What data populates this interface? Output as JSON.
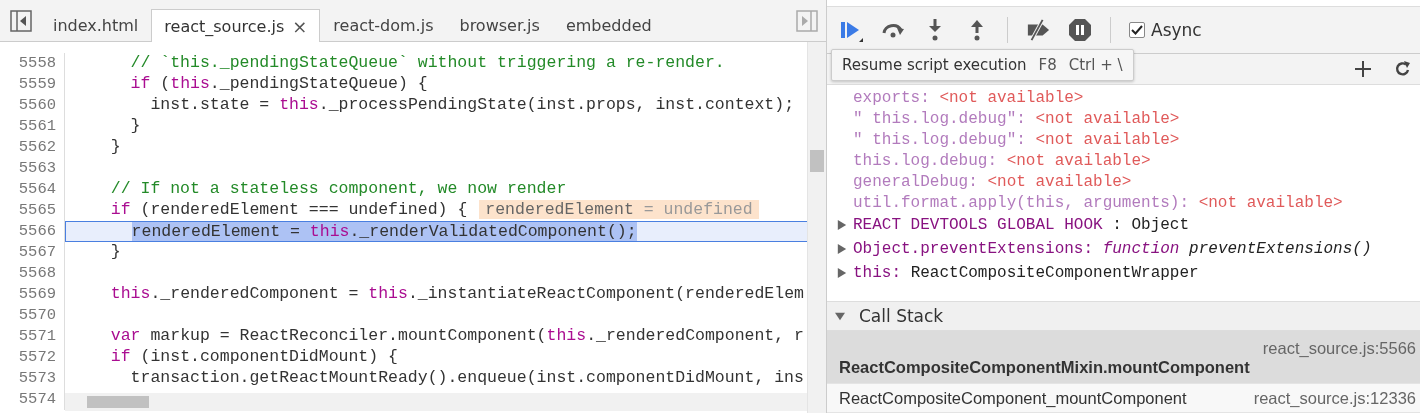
{
  "editor": {
    "tabs": [
      {
        "label": "index.html",
        "selected": false,
        "closable": false
      },
      {
        "label": "react_source.js",
        "selected": true,
        "closable": true
      },
      {
        "label": "react-dom.js",
        "selected": false,
        "closable": false
      },
      {
        "label": "browser.js",
        "selected": false,
        "closable": false
      },
      {
        "label": "embedded",
        "selected": false,
        "closable": false
      }
    ],
    "close_glyph": "×",
    "lines": [
      {
        "number": "5558",
        "segments": [
          {
            "kind": "comment",
            "text": "    // `this._pendingStateQueue` without triggering a re-render."
          }
        ]
      },
      {
        "number": "5559",
        "segments": [
          {
            "kind": "keyword",
            "text": "    if"
          },
          {
            "kind": "plain",
            "text": " ("
          },
          {
            "kind": "this",
            "text": "this"
          },
          {
            "kind": "plain",
            "text": "._pendingStateQueue) {"
          }
        ]
      },
      {
        "number": "5560",
        "segments": [
          {
            "kind": "plain",
            "text": "      inst.state = "
          },
          {
            "kind": "this",
            "text": "this"
          },
          {
            "kind": "plain",
            "text": "._processPendingState(inst.props, inst.context);"
          }
        ]
      },
      {
        "number": "5561",
        "segments": [
          {
            "kind": "plain",
            "text": "    }"
          }
        ]
      },
      {
        "number": "5562",
        "segments": [
          {
            "kind": "plain",
            "text": "  }"
          }
        ]
      },
      {
        "number": "5563"
      },
      {
        "number": "5564",
        "segments": [
          {
            "kind": "comment",
            "text": "  // If not a stateless component, we now render"
          }
        ]
      },
      {
        "number": "5565",
        "segments": [
          {
            "kind": "keyword",
            "text": "  if"
          },
          {
            "kind": "plain",
            "text": " (renderedElement === undefined) {"
          }
        ],
        "inline_value": {
          "name": "renderedElement",
          "value": "= undefined"
        }
      },
      {
        "number": "5566",
        "current": true,
        "segments": [
          {
            "kind": "selected",
            "text": "    renderedElement = "
          },
          {
            "kind": "selected-this",
            "text": "this"
          },
          {
            "kind": "selected",
            "text": "._renderValidatedComponent();"
          }
        ]
      },
      {
        "number": "5567",
        "segments": [
          {
            "kind": "plain",
            "text": "  }"
          }
        ]
      },
      {
        "number": "5568"
      },
      {
        "number": "5569",
        "segments": [
          {
            "kind": "this",
            "text": "  this"
          },
          {
            "kind": "plain",
            "text": "._renderedComponent = "
          },
          {
            "kind": "this",
            "text": "this"
          },
          {
            "kind": "plain",
            "text": "._instantiateReactComponent(renderedElem"
          }
        ]
      },
      {
        "number": "5570"
      },
      {
        "number": "5571",
        "segments": [
          {
            "kind": "keyword",
            "text": "  var"
          },
          {
            "kind": "plain",
            "text": " markup = ReactReconciler.mountComponent("
          },
          {
            "kind": "this",
            "text": "this"
          },
          {
            "kind": "plain",
            "text": "._renderedComponent, r"
          }
        ]
      },
      {
        "number": "5572",
        "segments": [
          {
            "kind": "keyword",
            "text": "  if"
          },
          {
            "kind": "plain",
            "text": " (inst.componentDidMount) {"
          }
        ]
      },
      {
        "number": "5573",
        "segments": [
          {
            "kind": "plain",
            "text": "    transaction.getReactMountReady().enqueue(inst.componentDidMount, ins"
          }
        ]
      },
      {
        "number": "5574"
      }
    ]
  },
  "debugger": {
    "async_checkbox": {
      "label": "Async",
      "checked": true
    },
    "tooltip": {
      "text": "Resume script execution",
      "shortcuts": [
        "F8",
        "Ctrl + \\"
      ]
    },
    "scope": [
      {
        "kind": "unavailable",
        "name": "exports:",
        "value": "<not available>"
      },
      {
        "kind": "unavailable",
        "name": "\" this.log.debug\":",
        "value": "<not available>"
      },
      {
        "kind": "unavailable",
        "name": "\" this.log.debug\":",
        "value": "<not available>"
      },
      {
        "kind": "unavailable",
        "name": "this.log.debug:",
        "value": "<not available>"
      },
      {
        "kind": "unavailable",
        "name": "generalDebug:",
        "value": "<not available>"
      },
      {
        "kind": "unavailable",
        "name": "util.format.apply(this, arguments):",
        "value": "<not available>"
      },
      {
        "kind": "object",
        "name": "REACT DEVTOOLS GLOBAL HOOK",
        "value": ": Object",
        "expanded": false
      },
      {
        "kind": "function",
        "name": "Object.preventExtensions:",
        "keyword": "function",
        "value": "preventExtensions()",
        "expanded": false
      },
      {
        "kind": "object",
        "name": "this:",
        "value": "ReactCompositeComponentWrapper",
        "expanded": false
      }
    ],
    "call_stack": {
      "title": "Call Stack",
      "expanded": true,
      "frames": [
        {
          "name": "ReactCompositeComponentMixin.mountComponent",
          "location": "react_source.js:5566",
          "selected": true
        },
        {
          "name": "ReactCompositeComponent_mountComponent",
          "location": "react_source.js:12336",
          "selected": false
        }
      ]
    }
  }
}
